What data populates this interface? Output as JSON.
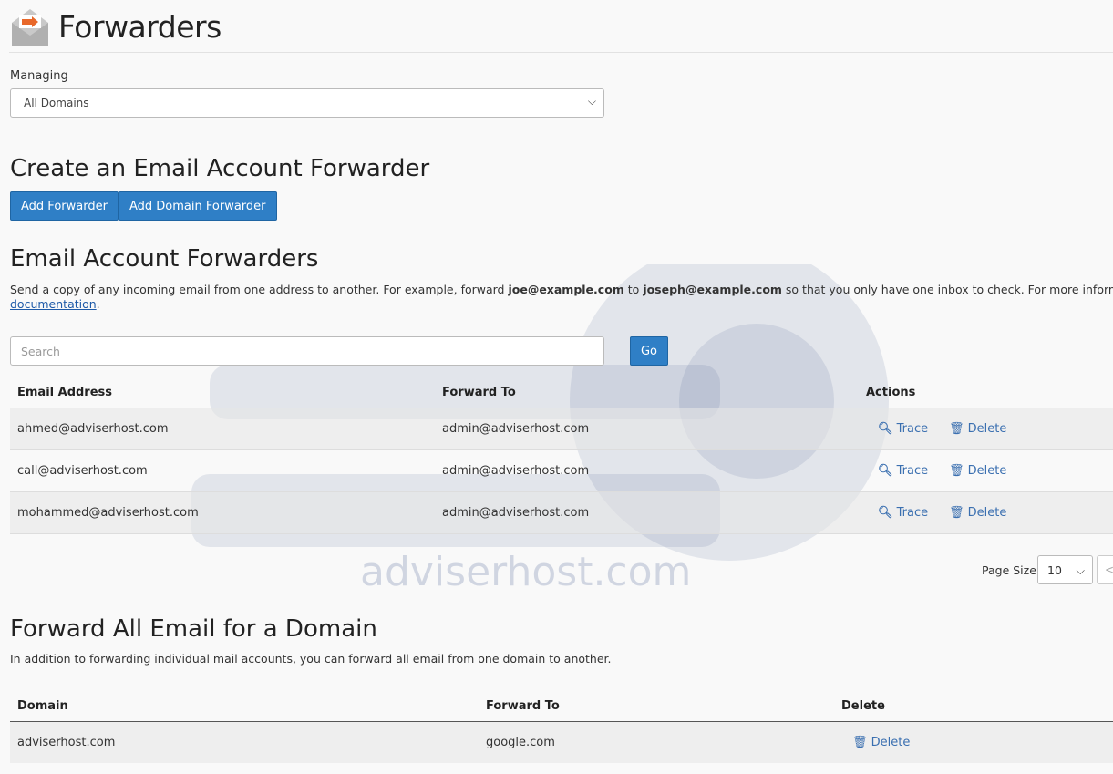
{
  "header": {
    "title": "Forwarders",
    "icon": "email-forward-icon"
  },
  "managing": {
    "label": "Managing",
    "selected": "All Domains"
  },
  "create": {
    "title": "Create an Email Account Forwarder",
    "add_forwarder": "Add Forwarder",
    "add_domain_forwarder": "Add Domain Forwarder"
  },
  "account_forwarders": {
    "title": "Email Account Forwarders",
    "desc_1": "Send a copy of any incoming email from one address to another. For example, forward ",
    "desc_example_from": "joe@example.com",
    "desc_2": " to ",
    "desc_example_to": "joseph@example.com",
    "desc_3": " so that you only have one inbox to check. For more information, ",
    "desc_link": "documentation",
    "desc_end": ".",
    "search_placeholder": "Search",
    "go": "Go",
    "columns": [
      "Email Address",
      "Forward To",
      "Actions"
    ],
    "rows": [
      {
        "email": "ahmed@adviserhost.com",
        "forward_to": "admin@adviserhost.com",
        "trace": "Trace",
        "delete": "Delete"
      },
      {
        "email": "call@adviserhost.com",
        "forward_to": "admin@adviserhost.com",
        "trace": "Trace",
        "delete": "Delete"
      },
      {
        "email": "mohammed@adviserhost.com",
        "forward_to": "admin@adviserhost.com",
        "trace": "Trace",
        "delete": "Delete"
      }
    ],
    "page_size_label": "Page Size",
    "page_size": "10",
    "prev": "<"
  },
  "domain_forwarders": {
    "title": "Forward All Email for a Domain",
    "desc": "In addition to forwarding individual mail accounts, you can forward all email from one domain to another.",
    "columns": [
      "Domain",
      "Forward To",
      "Delete"
    ],
    "rows": [
      {
        "domain": "adviserhost.com",
        "forward_to": "google.com",
        "delete": "Delete"
      }
    ]
  },
  "watermark": {
    "text": "adviserhost.com"
  },
  "colors": {
    "primary": "#2f7fc6",
    "link": "#3a6fb0",
    "accent": "#e8682a"
  }
}
